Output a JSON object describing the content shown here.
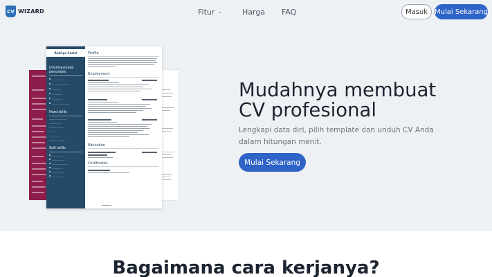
{
  "nav": {
    "logo_mark": "CV",
    "logo_text": "WIZARD",
    "fitur": "Fitur",
    "harga": "Harga",
    "faq": "FAQ",
    "masuk": "Masuk",
    "mulai": "Mulai Sekarang"
  },
  "cv": {
    "name": "Rodrigo Castel",
    "side_sections": [
      "Informaciones personais",
      "Hard skills",
      "Soft skills"
    ],
    "main_sections": [
      "Profile",
      "Employment",
      "Education",
      "Certificates"
    ]
  },
  "hero": {
    "title": "Mudahnya membuat CV profesional",
    "subtitle": "Lengkapi data diri, pilih template dan unduh CV Anda dalam hitungan menit.",
    "cta": "Mulai Sekarang"
  },
  "section": {
    "title": "Bagaimana cara kerjanya?"
  },
  "colors": {
    "accent": "#2e63c7",
    "hero_bg": "#eef1f4",
    "cv_sidebar": "#244a68",
    "cv_back_left": "#8e1d4b"
  }
}
